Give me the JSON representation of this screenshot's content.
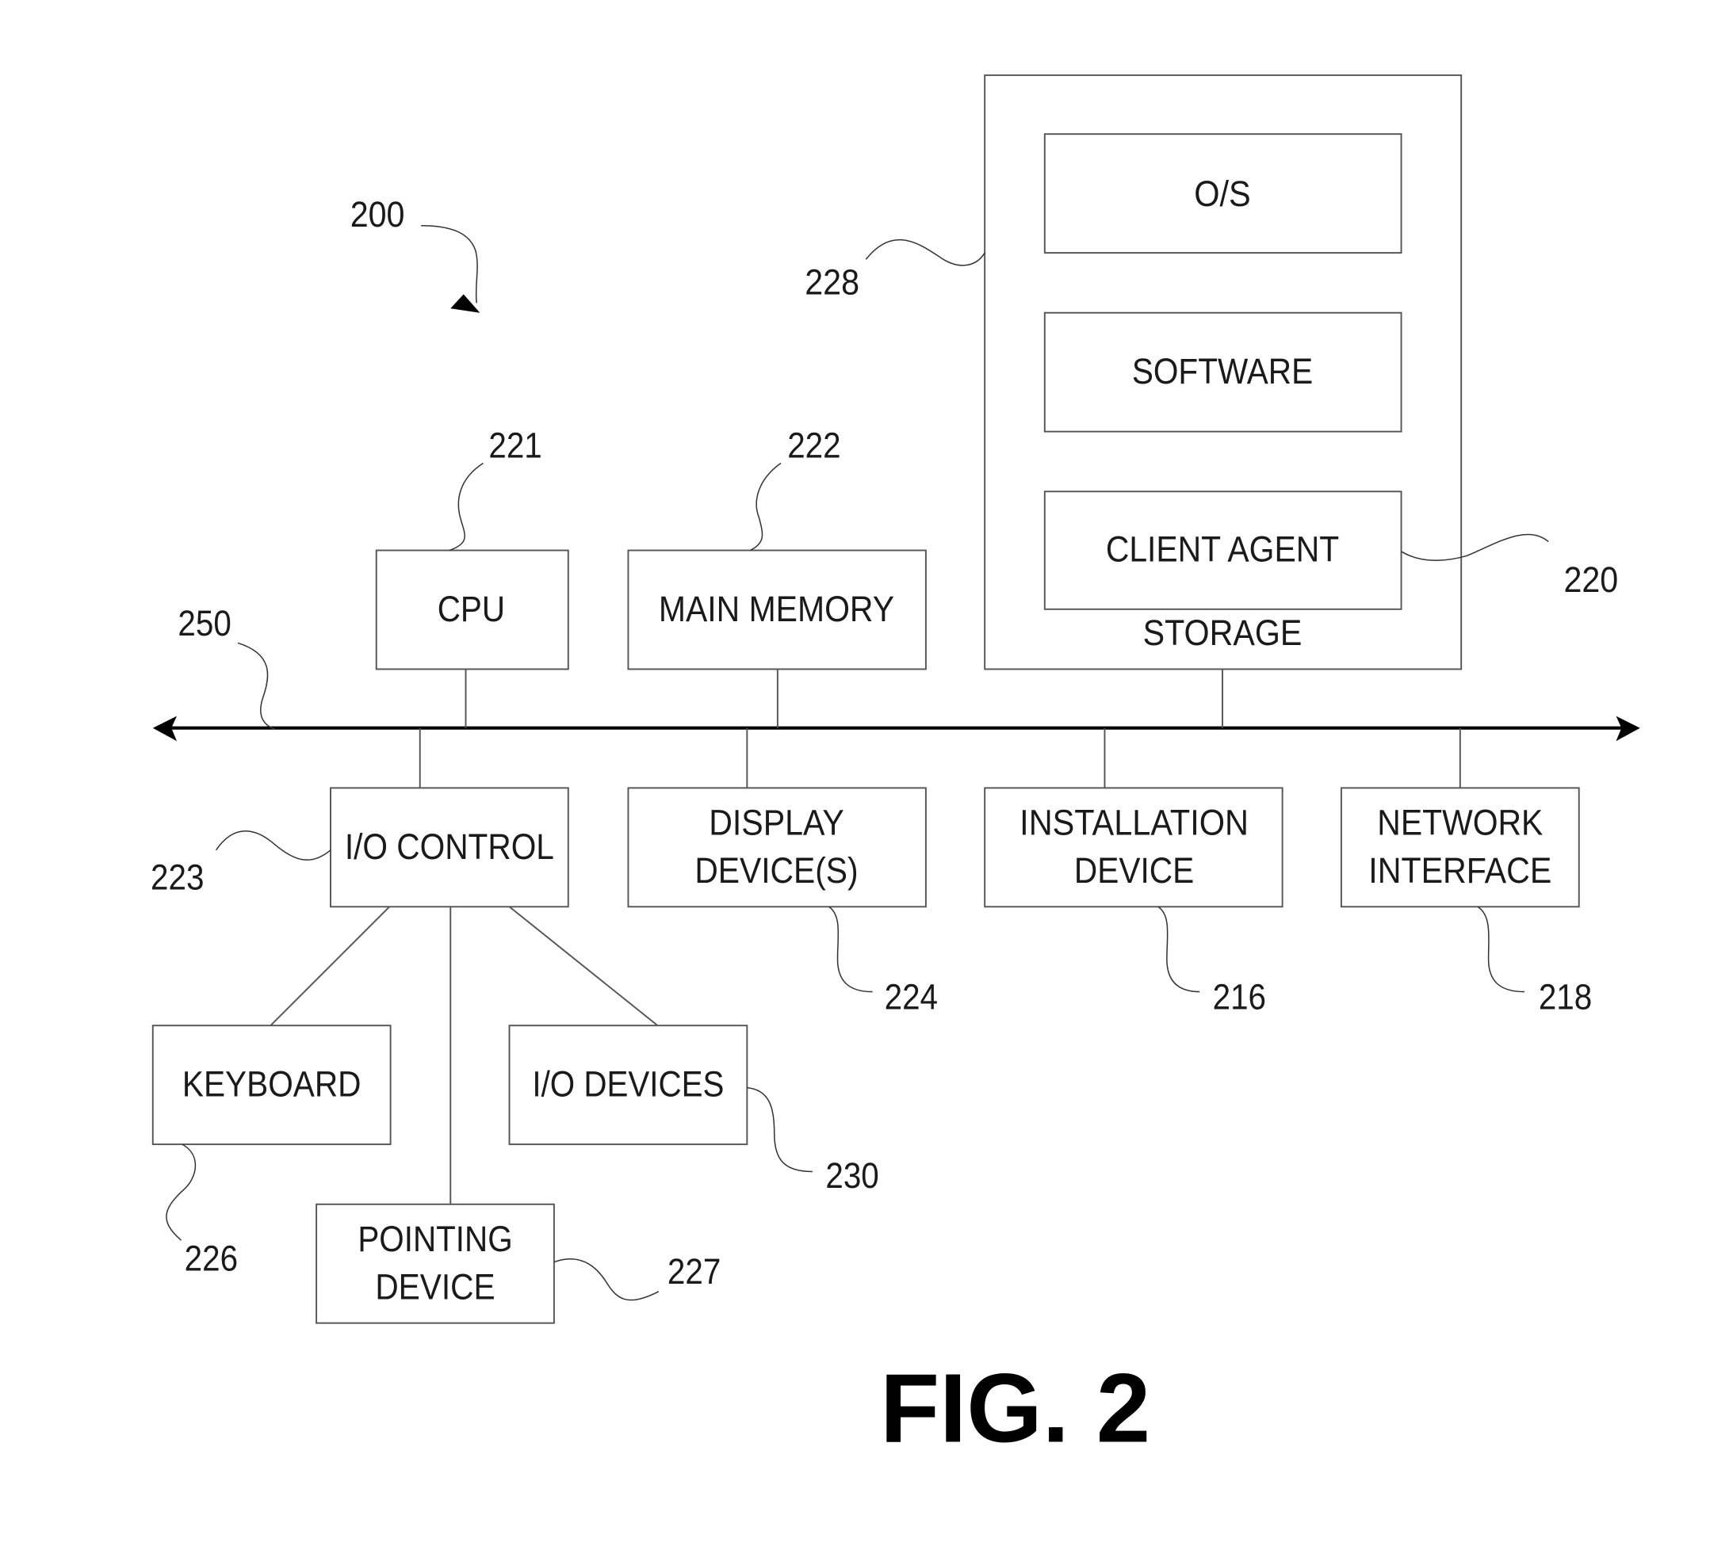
{
  "figure": {
    "title": "FIG. 2",
    "system_ref": "200",
    "bus_ref": "250"
  },
  "storage": {
    "label": "STORAGE",
    "ref": "228",
    "items": [
      {
        "label": "O/S"
      },
      {
        "label": "SOFTWARE"
      },
      {
        "label": "CLIENT AGENT",
        "ref": "220"
      }
    ]
  },
  "components": {
    "cpu": {
      "label": "CPU",
      "ref": "221"
    },
    "main_memory": {
      "label": "MAIN MEMORY",
      "ref": "222"
    },
    "io_control": {
      "label": "I/O CONTROL",
      "ref": "223"
    },
    "display": {
      "line1": "DISPLAY",
      "line2": "DEVICE(S)",
      "ref": "224"
    },
    "installation": {
      "line1": "INSTALLATION",
      "line2": "DEVICE",
      "ref": "216"
    },
    "network": {
      "line1": "NETWORK",
      "line2": "INTERFACE",
      "ref": "218"
    },
    "keyboard": {
      "label": "KEYBOARD",
      "ref": "226"
    },
    "io_devices": {
      "label": "I/O DEVICES",
      "ref": "230"
    },
    "pointing": {
      "line1": "POINTING",
      "line2": "DEVICE",
      "ref": "227"
    }
  }
}
